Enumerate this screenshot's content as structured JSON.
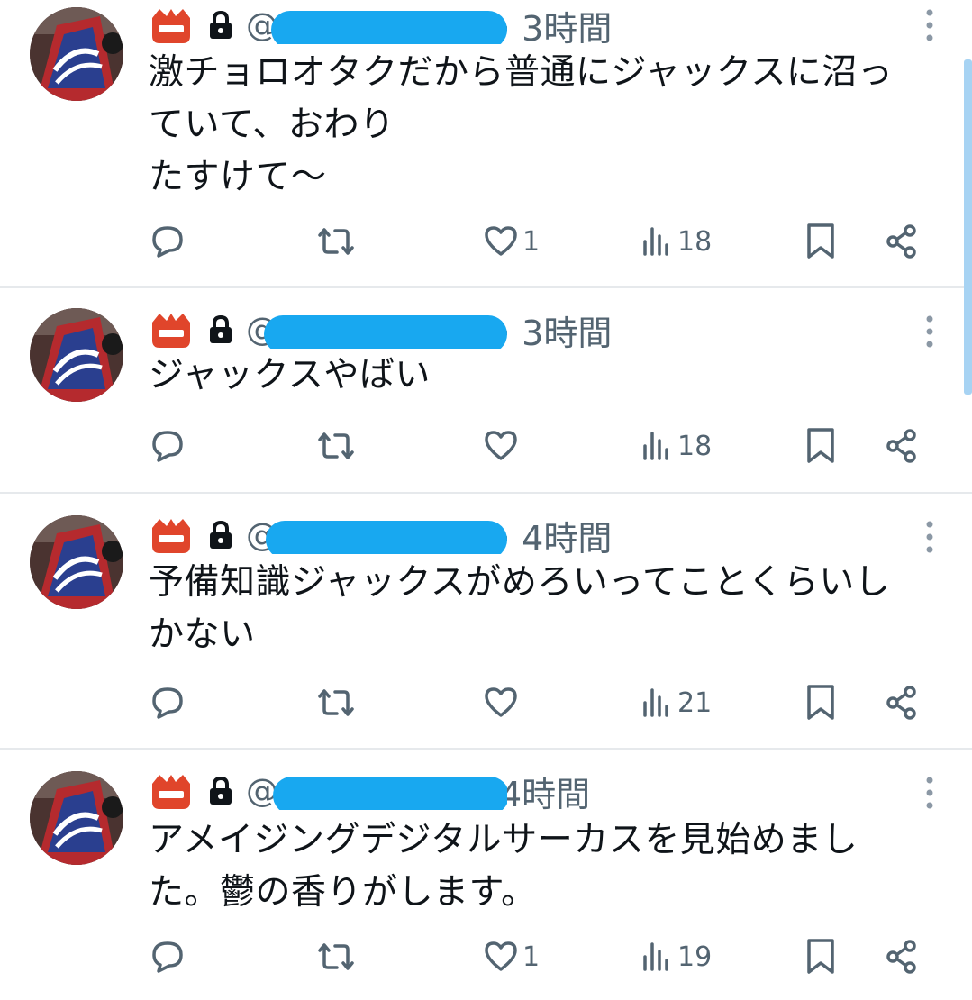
{
  "colors": {
    "text": "#0f1419",
    "secondary": "#536471",
    "divider": "#e6e9ec",
    "redaction": "#18a8f0",
    "badge": "#e0452b",
    "scrollbar": "#a7d3f3"
  },
  "tweets": [
    {
      "handle": "@",
      "time": "· 3時間",
      "text": "激チョロオタクだから普通にジャックスに沼っ\nていて、おわり\nたすけて〜",
      "likes": "1",
      "views": "18"
    },
    {
      "handle": "@",
      "time": "· 3時間",
      "text": "ジャックスやばい",
      "likes": "",
      "views": "18"
    },
    {
      "handle": "@",
      "time": "· 4時間",
      "text": "予備知識ジャックスがめろいってことくらいし\nかない",
      "likes": "",
      "views": "21"
    },
    {
      "handle": "@",
      "time": "4時間",
      "text": "アメイジングデジタルサーカスを見始めまし\nた。鬱の香りがします。",
      "likes": "1",
      "views": "19"
    }
  ],
  "icons": {
    "avatar": "avatar-image",
    "badge": "beginner-badge-icon",
    "lock": "lock-icon",
    "more": "more-icon",
    "reply": "reply-icon",
    "retweet": "retweet-icon",
    "like": "heart-icon",
    "views": "views-icon",
    "bookmark": "bookmark-icon",
    "share": "share-icon"
  }
}
